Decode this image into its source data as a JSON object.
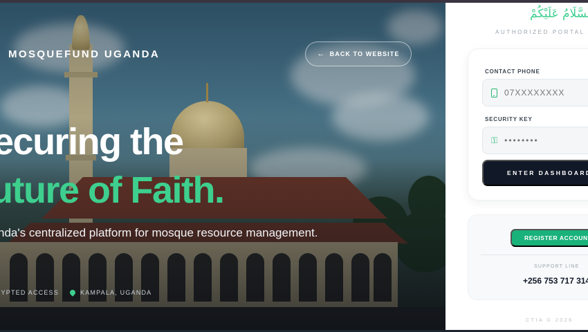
{
  "hero": {
    "brand": "MOSQUEFUND UGANDA",
    "back_label": "BACK TO WEBSITE",
    "headline_line1": "ecuring the",
    "headline_line2": "uture of Faith.",
    "tagline": "nda's centralized platform for mosque resource management.",
    "meta_access": "RYPTED ACCESS",
    "meta_location": "KAMPALA, UGANDA"
  },
  "panel": {
    "greeting": "السَّلَامُ عَلَيْكُمْ",
    "portal_label": "AUTHORIZED PORTAL AC",
    "phone_label": "CONTACT PHONE",
    "phone_placeholder": "07XXXXXXXX",
    "key_label": "SECURITY KEY",
    "key_placeholder": "••••••••",
    "enter_label": "ENTER DASHBOARD",
    "register_label": "REGISTER ACCOUNT",
    "support_label": "SUPPORT LINE",
    "support_phone": "+256 753 717 314",
    "footer": "CTIA © 2026"
  },
  "colors": {
    "accent_green": "#3ecf8e",
    "button_dark": "#111827",
    "register_green": "#19b27a"
  },
  "icons": [
    "arrow-left-icon",
    "map-pin-icon",
    "phone-icon",
    "key-icon"
  ]
}
